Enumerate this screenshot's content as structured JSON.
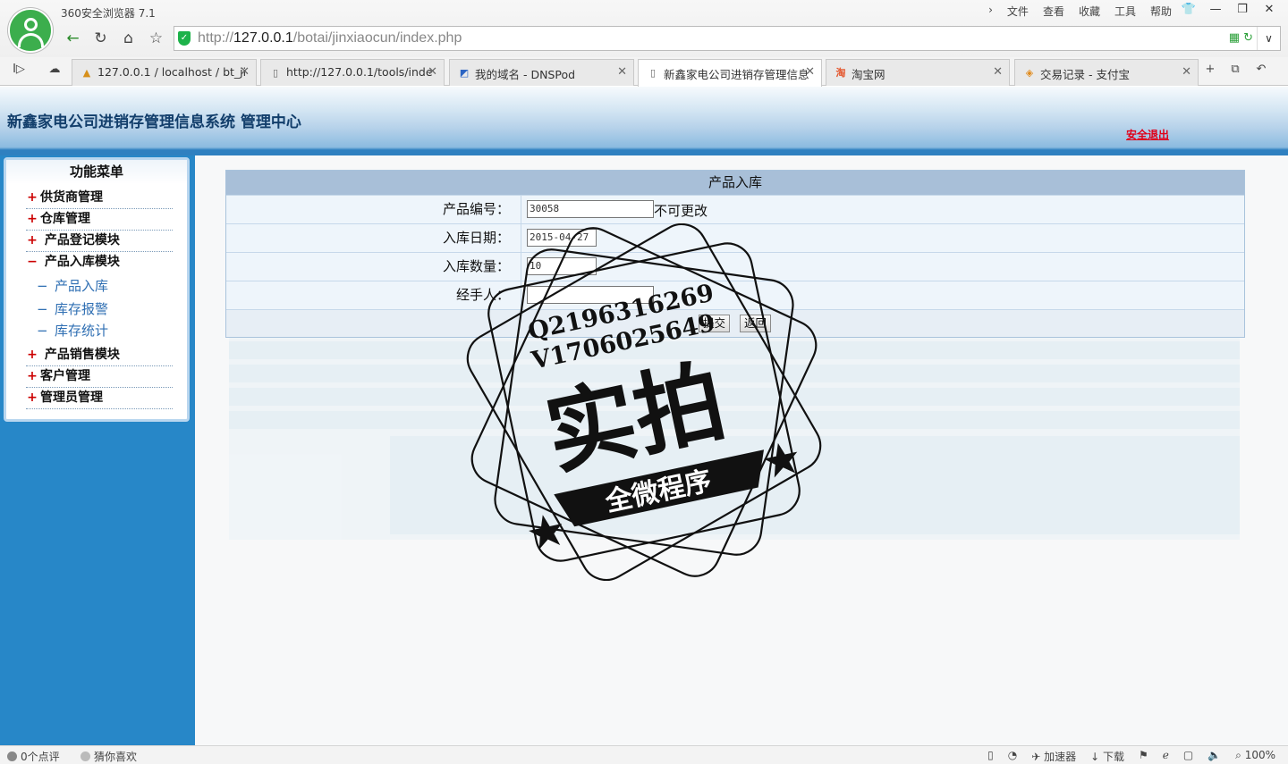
{
  "browser": {
    "app_title": "360安全浏览器 7.1",
    "menu": [
      "文件",
      "查看",
      "收藏",
      "工具",
      "帮助"
    ],
    "url_prefix": "http://",
    "url_host": "127.0.0.1",
    "url_path": "/botai/jinxiaocun/index.php",
    "tabs": [
      {
        "label": "127.0.0.1 / localhost / bt_ji",
        "icon": "phpmyadmin-icon"
      },
      {
        "label": "http://127.0.0.1/tools/inde",
        "icon": "page-icon"
      },
      {
        "label": "我的域名 - DNSPod",
        "icon": "dnspod-icon"
      },
      {
        "label": "新鑫家电公司进销存管理信息",
        "icon": "page-icon",
        "active": true
      },
      {
        "label": "淘宝网",
        "icon": "taobao-icon"
      },
      {
        "label": "交易记录 - 支付宝",
        "icon": "alipay-icon"
      }
    ]
  },
  "header": {
    "title": "新鑫家电公司进销存管理信息系统 管理中心",
    "logout": "安全退出"
  },
  "sidebar": {
    "title": "功能菜单",
    "items": [
      {
        "marker": "+",
        "label": "供货商管理"
      },
      {
        "marker": "+",
        "label": "仓库管理"
      },
      {
        "marker": "+",
        "label": " 产品登记模块"
      },
      {
        "marker": "−",
        "label": " 产品入库模块"
      },
      {
        "marker": "+",
        "label": " 产品销售模块"
      },
      {
        "marker": "+",
        "label": "客户管理"
      },
      {
        "marker": "+",
        "label": "管理员管理"
      }
    ],
    "subitems": [
      {
        "marker": "−",
        "label": "产品入库"
      },
      {
        "marker": "−",
        "label": "库存报警"
      },
      {
        "marker": "−",
        "label": "库存统计"
      }
    ]
  },
  "form": {
    "title": "产品入库",
    "rows": [
      {
        "label": "产品编号：",
        "value": "30058",
        "note": "不可更改"
      },
      {
        "label": "入库日期：",
        "value": "2015-04-27"
      },
      {
        "label": "入库数量：",
        "value": "10"
      },
      {
        "label": "经手人：",
        "value": ""
      }
    ],
    "submit": "提交",
    "back": "返回"
  },
  "watermark": {
    "line1": "Q2196316269",
    "line2": "V1706025649",
    "main": "实拍",
    "banner": "全微程序"
  },
  "status": {
    "comments": "0个点评",
    "likes": "猜你喜欢",
    "accelerator": "加速器",
    "download": "下载",
    "zoom": "100%"
  }
}
